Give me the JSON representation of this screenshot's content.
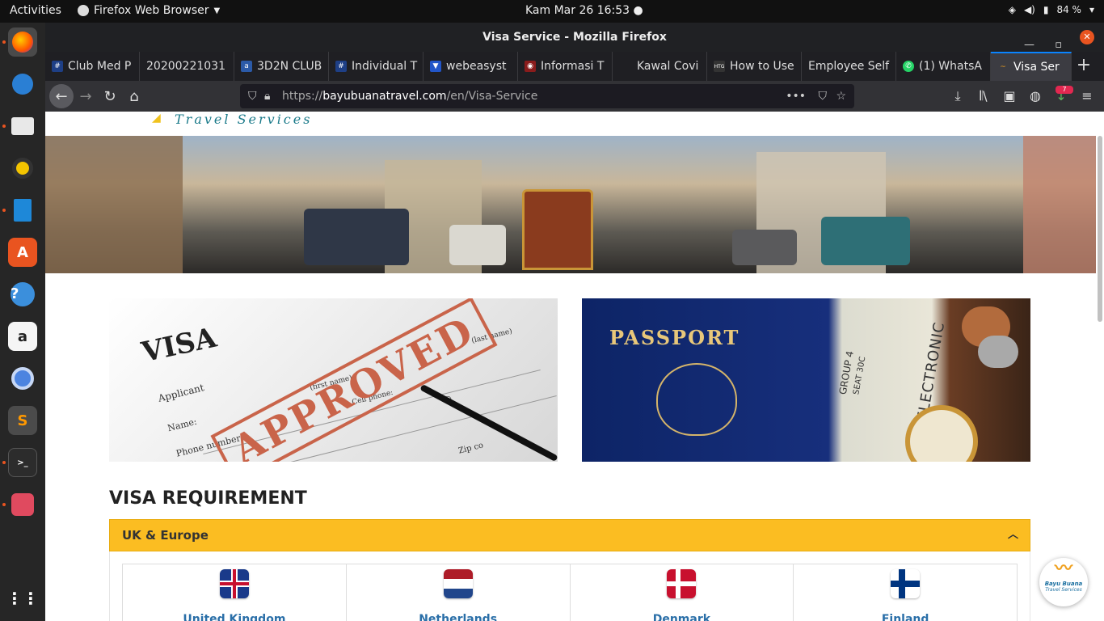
{
  "topbar": {
    "activities": "Activities",
    "app_name": "Firefox Web Browser",
    "clock": "Kam Mar 26  16:53",
    "battery": "84 %"
  },
  "window": {
    "title": "Visa Service - Mozilla Firefox"
  },
  "tabs": [
    {
      "label": "Club Med P",
      "icon": "hashtag-icon"
    },
    {
      "label": "20200221031",
      "icon": "blank-icon"
    },
    {
      "label": "3D2N CLUB",
      "icon": "ado-icon"
    },
    {
      "label": "Individual T",
      "icon": "hashtag-icon"
    },
    {
      "label": "webeasyst",
      "icon": "shield-icon"
    },
    {
      "label": "Informasi T",
      "icon": "covid-icon"
    },
    {
      "label": "Kawal Covi",
      "icon": "blank-icon"
    },
    {
      "label": "How to Use",
      "icon": "htg-icon"
    },
    {
      "label": "Employee Self",
      "icon": "blank-icon"
    },
    {
      "label": "(1) WhatsA",
      "icon": "whatsapp-icon"
    },
    {
      "label": "Visa Ser",
      "icon": "bayu-icon"
    }
  ],
  "urlbar": {
    "prefix": "https://",
    "host": "bayubuanatravel.com",
    "path": "/en/Visa-Service"
  },
  "downloads_badge": "7",
  "page": {
    "logo_text": "Travel Services",
    "visa_image": {
      "title": "VISA",
      "stamp": "APPROVED",
      "field_applicant": "Applicant",
      "field_name": "Name:",
      "field_first": "(first name)",
      "field_last": "(last name)",
      "field_phone": "Phone number",
      "field_cell": "Cell phone:",
      "field_zip": "Zip co",
      "field_at": "@"
    },
    "passport_image": {
      "title": "PASSPORT",
      "ticket_text": "ELECTRONIC",
      "group": "GROUP 4",
      "seat": "SEAT 30C"
    },
    "section_title": "VISA REQUIREMENT",
    "accordion": {
      "label": "UK & Europe"
    },
    "countries": [
      {
        "name": "United Kingdom",
        "flag": "uk-flag-icon"
      },
      {
        "name": "Netherlands",
        "flag": "netherlands-flag-icon"
      },
      {
        "name": "Denmark",
        "flag": "denmark-flag-icon"
      },
      {
        "name": "Finland",
        "flag": "finland-flag-icon"
      }
    ],
    "badge": {
      "line1": "Bayu Buana",
      "line2": "Travel Services"
    }
  }
}
